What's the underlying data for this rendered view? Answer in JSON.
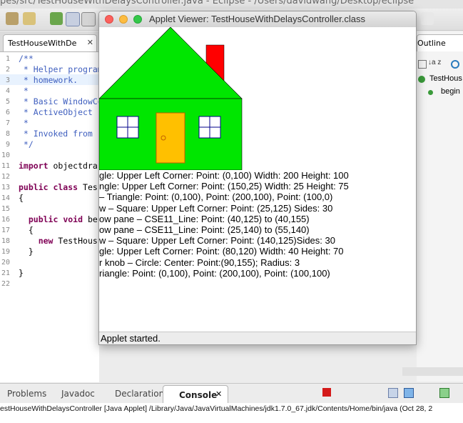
{
  "eclipse": {
    "title": "pes/src/TestHouseWithDelaysController.java - Eclipse - /Users/davidwang/Desktop/eclipse"
  },
  "editor": {
    "tab_label": "TestHouseWithDe",
    "lines": [
      {
        "n": "1",
        "text": "/**"
      },
      {
        "n": "2",
        "text": " * Helper program"
      },
      {
        "n": "3",
        "text": " * homework."
      },
      {
        "n": "4",
        "text": " *"
      },
      {
        "n": "5",
        "text": " * Basic WindowCo"
      },
      {
        "n": "6",
        "text": " * ActiveObject"
      },
      {
        "n": "7",
        "text": " *"
      },
      {
        "n": "8",
        "text": " * Invoked from"
      },
      {
        "n": "9",
        "text": " */"
      },
      {
        "n": "10",
        "text": ""
      },
      {
        "n": "11",
        "text": "import objectdra"
      },
      {
        "n": "12",
        "text": ""
      },
      {
        "n": "13",
        "text": "public class Tes"
      },
      {
        "n": "14",
        "text": "{"
      },
      {
        "n": "15",
        "text": ""
      },
      {
        "n": "16",
        "text": "  public void be"
      },
      {
        "n": "17",
        "text": "  {"
      },
      {
        "n": "18",
        "text": "    new TestHous"
      },
      {
        "n": "19",
        "text": "  }"
      },
      {
        "n": "20",
        "text": ""
      },
      {
        "n": "21",
        "text": "}"
      },
      {
        "n": "22",
        "text": ""
      }
    ]
  },
  "outline": {
    "tab_label": "Outline",
    "items": [
      "TestHous",
      "begin"
    ]
  },
  "applet": {
    "title": "Applet Viewer: TestHouseWithDelaysController.class",
    "status": "Applet started.",
    "log_lines": [
      "gle: Upper Left Corner: Point: (0,100) Width: 200 Height: 100",
      "ngle: Upper Left Corner: Point: (150,25) Width: 25 Height: 75",
      "– Triangle: Point: (0,100), Point: (200,100), Point: (100,0)",
      "w – Square: Upper Left Corner: Point: (25,125) Sides: 30",
      "ow pane – CSE11_Line: Point: (40,125) to (40,155)",
      "ow pane – CSE11_Line: Point: (25,140) to (55,140)",
      "w – Square: Upper Left Corner: Point: (140,125)Sides: 30",
      "gle: Upper Left Corner: Point: (80,120) Width: 40 Height: 70",
      "r knob – Circle: Center: Point:(90,155); Radius: 3",
      "riangle: Point: (0,100), Point: (200,100), Point: (100,100)"
    ],
    "colors": {
      "house": "#00e600",
      "chimney": "#ff0000",
      "door": "#ffc000",
      "window_border": "#00008b"
    }
  },
  "console": {
    "tabs": [
      "Problems",
      "Javadoc",
      "Declaration",
      "Console"
    ],
    "line": "estHouseWithDelaysController [Java Applet] /Library/Java/JavaVirtualMachines/jdk1.7.0_67.jdk/Contents/Home/bin/java (Oct 28, 2"
  }
}
